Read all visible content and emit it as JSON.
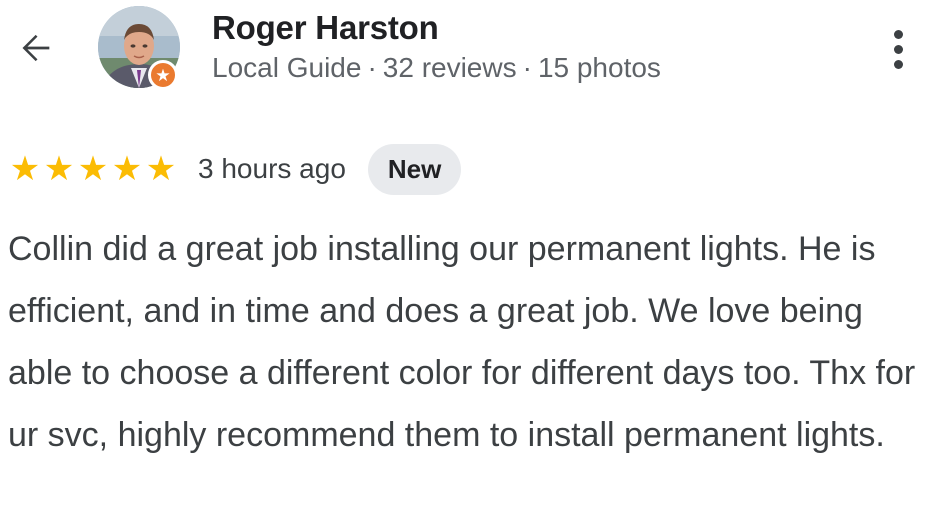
{
  "header": {
    "back_icon": "arrow-left-icon",
    "more_icon": "more-vert-icon"
  },
  "author": {
    "name": "Roger Harston",
    "badge_icon": "local-guide-star-icon",
    "badge_color": "#ea7a2f",
    "meta": {
      "title": "Local Guide",
      "reviews": "32 reviews",
      "photos": "15 photos",
      "separator": "·"
    }
  },
  "review": {
    "rating": 5,
    "max_rating": 5,
    "star_color": "#fbbc04",
    "time_ago": "3 hours ago",
    "badge": "New",
    "text": "Collin did a great job installing our permanent lights. He is efficient, and in time and does a great job. We love being able to choose a different color for different days too. Thx for ur svc, highly recommend them to install permanent lights."
  }
}
